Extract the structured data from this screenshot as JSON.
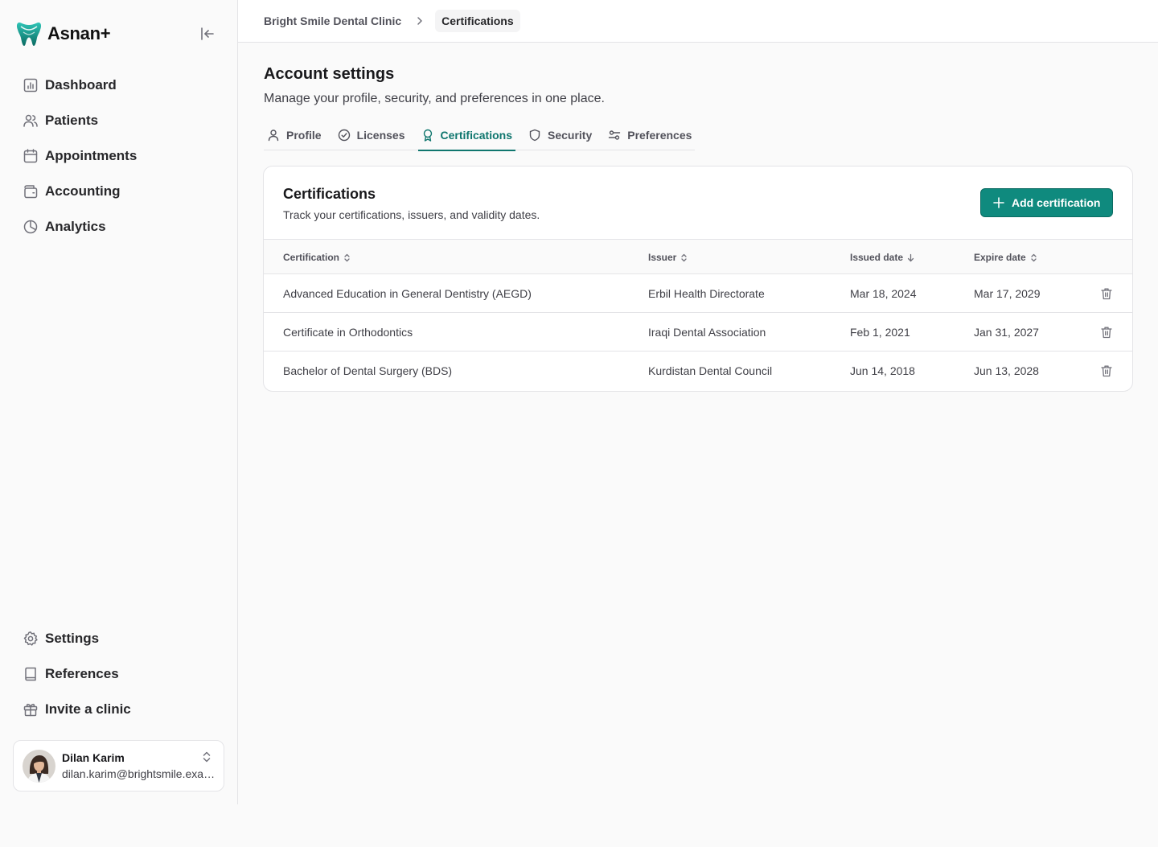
{
  "app": {
    "name": "Asnan+",
    "brand_color": "#0f8a7e"
  },
  "sidebar": {
    "top_items": [
      {
        "label": "Dashboard",
        "icon": "dashboard-icon"
      },
      {
        "label": "Patients",
        "icon": "users-icon"
      },
      {
        "label": "Appointments",
        "icon": "calendar-icon"
      },
      {
        "label": "Accounting",
        "icon": "wallet-icon"
      },
      {
        "label": "Analytics",
        "icon": "pie-chart-icon"
      }
    ],
    "bottom_items": [
      {
        "label": "Settings",
        "icon": "gear-icon"
      },
      {
        "label": "References",
        "icon": "book-icon"
      },
      {
        "label": "Invite a clinic",
        "icon": "gift-icon"
      }
    ],
    "user": {
      "name": "Dilan Karim",
      "email": "dilan.karim@brightsmile.example"
    }
  },
  "breadcrumb": {
    "parent": "Bright Smile Dental Clinic",
    "current": "Certifications"
  },
  "page": {
    "title": "Account settings",
    "subtitle": "Manage your profile, security, and preferences in one place."
  },
  "tabs": [
    {
      "label": "Profile",
      "icon": "user-icon",
      "active": false
    },
    {
      "label": "Licenses",
      "icon": "check-circle-icon",
      "active": false
    },
    {
      "label": "Certifications",
      "icon": "award-icon",
      "active": true
    },
    {
      "label": "Security",
      "icon": "shield-icon",
      "active": false
    },
    {
      "label": "Preferences",
      "icon": "sliders-icon",
      "active": false
    }
  ],
  "card": {
    "title": "Certifications",
    "subtitle": "Track your certifications, issuers, and validity dates.",
    "add_button": "Add certification"
  },
  "table": {
    "columns": [
      {
        "label": "Certification",
        "sort": "none"
      },
      {
        "label": "Issuer",
        "sort": "none"
      },
      {
        "label": "Issued date",
        "sort": "desc"
      },
      {
        "label": "Expire date",
        "sort": "none"
      }
    ],
    "rows": [
      {
        "certification": "Advanced Education in General Dentistry (AEGD)",
        "issuer": "Erbil Health Directorate",
        "issued": "Mar 18, 2024",
        "expires": "Mar 17, 2029"
      },
      {
        "certification": "Certificate in Orthodontics",
        "issuer": "Iraqi Dental Association",
        "issued": "Feb 1, 2021",
        "expires": "Jan 31, 2027"
      },
      {
        "certification": "Bachelor of Dental Surgery (BDS)",
        "issuer": "Kurdistan Dental Council",
        "issued": "Jun 14, 2018",
        "expires": "Jun 13, 2028"
      }
    ]
  }
}
